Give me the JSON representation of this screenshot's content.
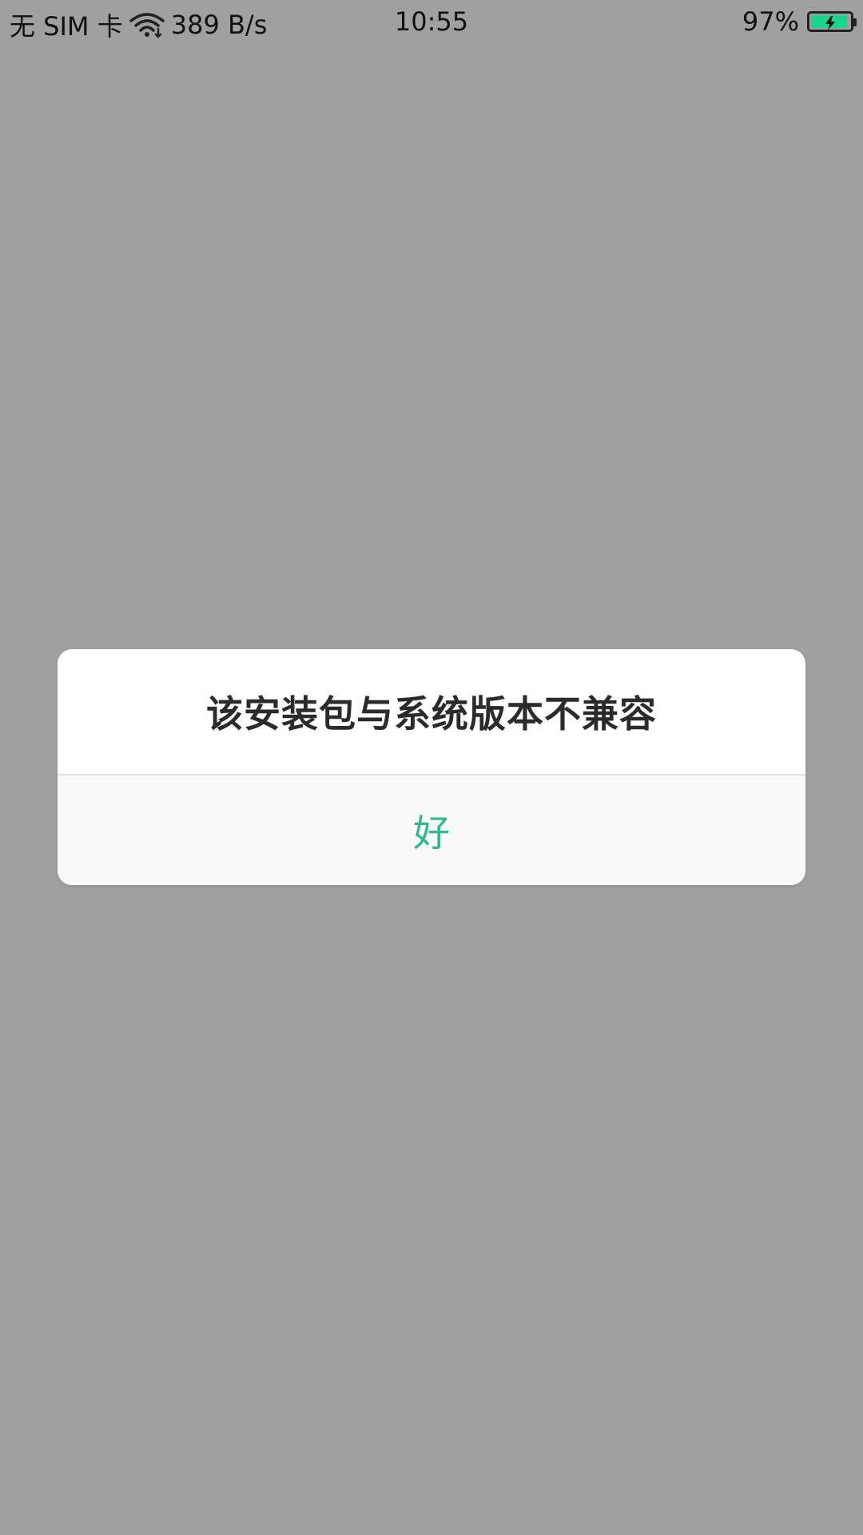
{
  "status_bar": {
    "sim": "无 SIM 卡",
    "network_speed": "389 B/s",
    "time": "10:55",
    "battery_percent_text": "97%",
    "battery_level": 0.97,
    "battery_color": "#17d58c",
    "icons": [
      "wifi-icon",
      "battery-icon",
      "charging-bolt-icon"
    ]
  },
  "dialog": {
    "title": "该安装包与系统版本不兼容",
    "ok_label": "好",
    "accent_color": "#2fba8b"
  },
  "colors": {
    "scrim": "#a0a0a0",
    "dialog_bg": "#ffffff",
    "button_bg": "#f9f9f9",
    "title_text": "#2b2b2b"
  }
}
